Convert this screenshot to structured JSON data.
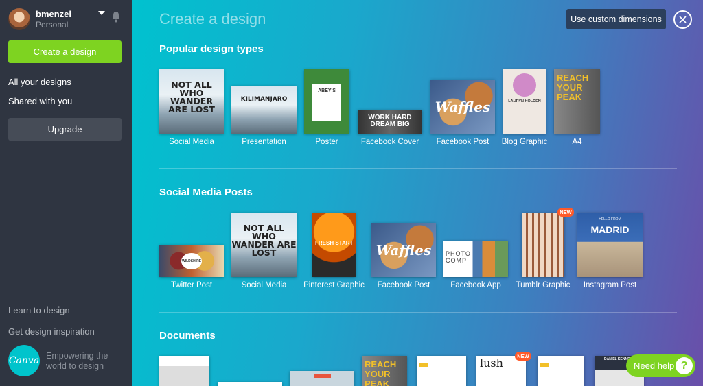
{
  "user": {
    "name": "bmenzel",
    "plan": "Personal"
  },
  "sidebar": {
    "create_label": "Create a design",
    "links": [
      "All your designs",
      "Shared with you"
    ],
    "upgrade_label": "Upgrade",
    "bottom_links": [
      "Learn to design",
      "Get design inspiration"
    ],
    "logo_text": "Canva",
    "tagline": "Empowering the world to design"
  },
  "header": {
    "title": "Create a design",
    "custom_dimensions_label": "Use custom dimensions"
  },
  "sections": [
    {
      "title": "Popular design types",
      "items": [
        {
          "label": "Social Media",
          "thumb_text": "NOT ALL WHO WANDER ARE LOST"
        },
        {
          "label": "Presentation",
          "thumb_text": "KILIMANJARO"
        },
        {
          "label": "Poster",
          "thumb_text": "ABEY'S"
        },
        {
          "label": "Facebook Cover",
          "thumb_text": "WORK HARD DREAM BIG"
        },
        {
          "label": "Facebook Post",
          "thumb_text": "Waffles"
        },
        {
          "label": "Blog Graphic",
          "thumb_text": "LAURYN HOLDEN"
        },
        {
          "label": "A4",
          "thumb_text": "REACH YOUR PEAK"
        }
      ]
    },
    {
      "title": "Social Media Posts",
      "items": [
        {
          "label": "Twitter Post",
          "thumb_text": "WILDSHIRE"
        },
        {
          "label": "Social Media",
          "thumb_text": "NOT ALL WHO WANDER ARE LOST"
        },
        {
          "label": "Pinterest Graphic",
          "thumb_text": "FRESH START"
        },
        {
          "label": "Facebook Post",
          "thumb_text": "Waffles"
        },
        {
          "label": "Facebook App",
          "thumb_text": "PHOTO COMP"
        },
        {
          "label": "Tumblr Graphic",
          "badge": "NEW"
        },
        {
          "label": "Instagram Post",
          "thumb_text": "MADRID",
          "thumb_sub": "HELLO FROM"
        }
      ]
    },
    {
      "title": "Documents",
      "items": [
        {
          "thumb_text": "REACH YOUR PEAK"
        },
        {
          "thumb_text": "lush",
          "badge": "NEW"
        },
        {
          "thumb_text": "DANIEL KENNEDY"
        }
      ]
    }
  ],
  "help": {
    "label": "Need help",
    "icon": "?"
  },
  "colors": {
    "accent_green": "#7ed321",
    "sidebar_bg": "#2f3541",
    "badge_red": "#ff5a29"
  }
}
